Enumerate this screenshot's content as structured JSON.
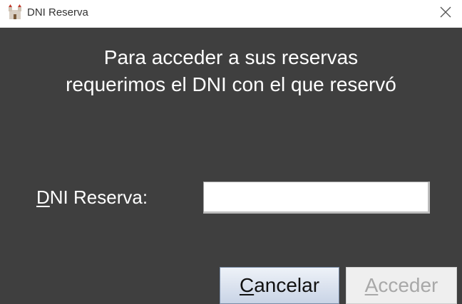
{
  "window": {
    "title": "DNI Reserva",
    "close_glyph": "✕",
    "app_icon": "castle-icon"
  },
  "message": {
    "line1": "Para acceder a sus reservas",
    "line2": "requerimos el DNI con el que reservó"
  },
  "form": {
    "dni_label_mnemonic": "D",
    "dni_label_rest": "NI Reserva:",
    "dni_value": ""
  },
  "buttons": {
    "cancel_mnemonic": "C",
    "cancel_rest": "ancelar",
    "accept_mnemonic": "A",
    "accept_rest": "cceder",
    "accept_enabled": false
  }
}
